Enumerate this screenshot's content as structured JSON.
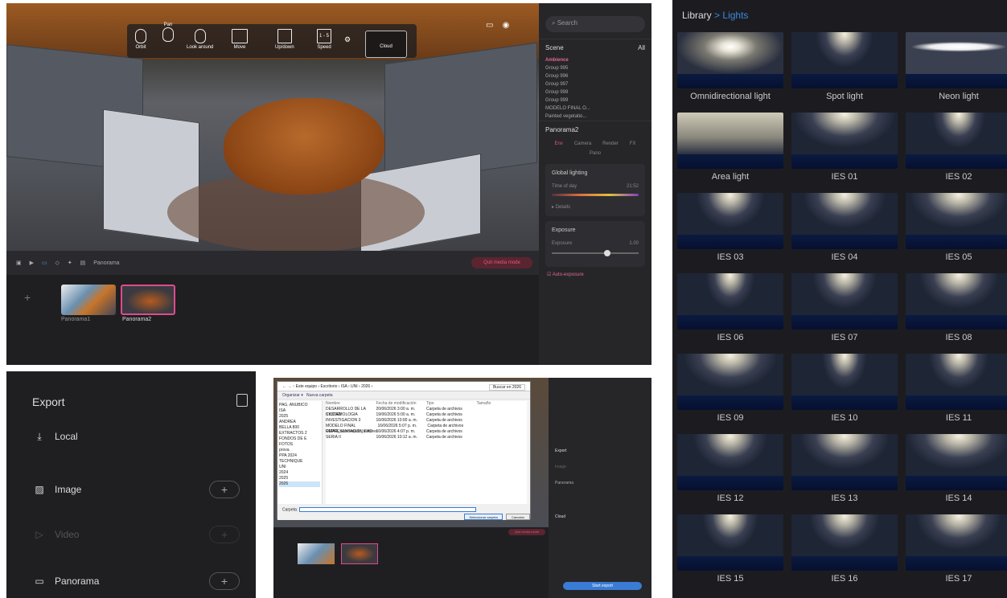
{
  "viewer": {
    "toolbar": {
      "orbit": "Orbit",
      "pan": "Pan",
      "look_around": "Look around",
      "move": "Move",
      "updown": "Up/down",
      "speed": "Speed",
      "speed_value": "1 - 5",
      "cloud": "Cloud"
    },
    "bottom_bar": {
      "mode": "Panorama",
      "quit": "Quit media mode"
    },
    "thumbnails": [
      "Panorama1",
      "Panorama2"
    ],
    "add": "+",
    "side": {
      "search_placeholder": "Search",
      "scene_label": "Scene",
      "scene_filter": "All",
      "ambience": "Ambience",
      "items": [
        "Group 995",
        "Group 996",
        "Group 997",
        "Group 998",
        "Group 999",
        "MODELO FINAL O...",
        "Painted vegetatio..."
      ],
      "panorama_title": "Panorama2",
      "tabs": [
        "Env",
        "Camera",
        "Render",
        "FX",
        "Pano"
      ],
      "global_lighting": "Global lighting",
      "time_of_day": "Time of day",
      "time_value": "21:52",
      "details": "Details",
      "exposure_title": "Exposure",
      "exposure_label": "Exposure",
      "exposure_value": "1.00",
      "auto_exposure": "Auto-exposure"
    }
  },
  "export": {
    "title": "Export",
    "local": "Local",
    "image": "Image",
    "video": "Video",
    "panorama": "Panorama",
    "plus": "+"
  },
  "dialog": {
    "address": "Este equipo › Escritorio › ISA › UNI › 2026 ›",
    "search_placeholder": "Buscar en 2026",
    "organize": "Organizar ▾",
    "new_folder": "Nueva carpeta",
    "tree": [
      "PAG. ANUBICO",
      "ISA",
      "2025",
      "ANDREA",
      "BELLA 800",
      "EXTRACTOS 2",
      "FONDOS DE E",
      "FOTOS",
      "prova",
      "PPA 2024",
      "TECHNIQUE",
      "UNI",
      "2024",
      "2025",
      "2026"
    ],
    "columns": [
      "Nombre",
      "Fecha de modificación",
      "Tipo",
      "Tamaño"
    ],
    "files": [
      [
        "DESARROLLO DE LA CIUDAD",
        "20/06/2026 3:00 a. m.",
        "Carpeta de archivos",
        ""
      ],
      [
        "SYSTEMOLOGIA",
        "19/06/2026 5:00 a. m.",
        "Carpeta de archivos",
        ""
      ],
      [
        "INVESTIGACION 3",
        "16/06/2026 10:00 a. m.",
        "Carpeta de archivos",
        ""
      ],
      [
        "MODELO FINAL OMAR_acomodado_textures",
        "16/06/2026 5:07 p. m.",
        "Carpeta de archivos",
        ""
      ],
      [
        "REPRESENTACION CAD",
        "16/06/2026 4:07 p. m.",
        "Carpeta de archivos",
        ""
      ],
      [
        "SERIA II",
        "16/06/2026 10:12 a. m.",
        "Carpeta de archivos",
        ""
      ]
    ],
    "folder_label": "Carpeta:",
    "select_btn": "Seleccionar carpeta",
    "cancel_btn": "Cancelar",
    "side_export": "Export",
    "side_image": "Image",
    "side_panorama": "Panorama",
    "side_cloud": "Cloud",
    "start_export": "Start export",
    "quit": "Quit media mode"
  },
  "library": {
    "prefix": "Library",
    "sep": ">",
    "section": "Lights",
    "items": [
      "Omnidirectional light",
      "Spot light",
      "Neon light",
      "Area light",
      "IES 01",
      "IES 02",
      "IES 03",
      "IES 04",
      "IES 05",
      "IES 06",
      "IES 07",
      "IES 08",
      "IES 09",
      "IES 10",
      "IES 11",
      "IES 12",
      "IES 13",
      "IES 14",
      "IES 15",
      "IES 16",
      "IES 17"
    ]
  }
}
